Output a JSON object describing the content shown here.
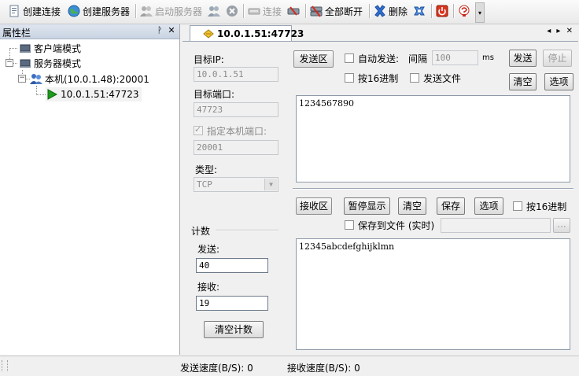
{
  "toolbar": {
    "create_connection": "创建连接",
    "create_server": "创建服务器",
    "start_server": "启动服务器",
    "connect": "连接",
    "disconnect_all": "全部断开",
    "delete": "删除"
  },
  "left_panel": {
    "title": "属性栏",
    "pin": "ᚹ",
    "close": "✕",
    "tree": {
      "client_mode": "客户端模式",
      "server_mode": "服务器模式",
      "local_host": "本机(10.0.1.48):20001",
      "connection": "10.0.1.51:47723"
    }
  },
  "tab": {
    "label": "10.0.1.51:47723",
    "nav": "◂ ▸ ✕"
  },
  "target": {
    "ip_label": "目标IP:",
    "ip_value": "10.0.1.51",
    "port_label": "目标端口:",
    "port_value": "47723",
    "local_port_check_label": "指定本机端口:",
    "local_port_value": "20001",
    "type_label": "类型:",
    "type_value": "TCP"
  },
  "counter": {
    "group_label": "计数",
    "send_label": "发送:",
    "send_value": "40",
    "recv_label": "接收:",
    "recv_value": "19",
    "clear_button": "清空计数"
  },
  "send_area": {
    "title_button": "发送区",
    "auto_send_label": "自动发送:",
    "interval_label": "间隔",
    "interval_value": "100",
    "interval_unit": "ms",
    "send_button": "发送",
    "stop_button": "停止",
    "hex_label": "按16进制",
    "send_file_label": "发送文件",
    "clear_button": "清空",
    "options_button": "选项",
    "content": "1234567890"
  },
  "recv_area": {
    "title_button": "接收区",
    "pause_button": "暂停显示",
    "clear_button": "清空",
    "save_button": "保存",
    "options_button": "选项",
    "hex_label": "按16进制",
    "save_to_file_label": "保存到文件 (实时)",
    "browse_button": "...",
    "content": "12345abcdefghijklmn"
  },
  "status": {
    "send_speed": "发送速度(B/S): 0",
    "recv_speed": "接收速度(B/S): 0"
  },
  "colors": {
    "accent": "#3a6ec2",
    "play_green": "#1e9a1e",
    "stop_red": "#d42a1a"
  }
}
